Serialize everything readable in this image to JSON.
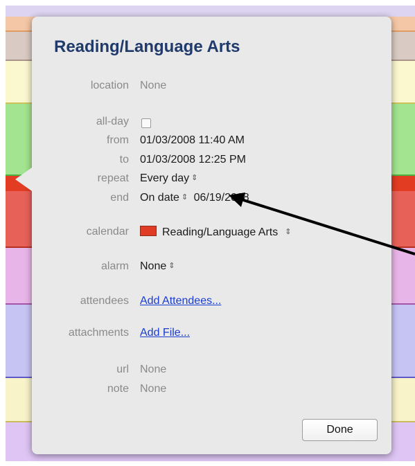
{
  "event": {
    "title": "Reading/Language Arts",
    "fields": {
      "location": {
        "label": "location",
        "value": "None"
      },
      "all_day": {
        "label": "all-day",
        "checked": false
      },
      "from": {
        "label": "from",
        "value": "01/03/2008 11:40 AM"
      },
      "to": {
        "label": "to",
        "value": "01/03/2008 12:25 PM"
      },
      "repeat": {
        "label": "repeat",
        "value": "Every day",
        "stepper": "⇕"
      },
      "end": {
        "label": "end",
        "value": "On date",
        "stepper": "⇕",
        "date": "06/19/2008"
      },
      "calendar": {
        "label": "calendar",
        "value": "Reading/Language Arts",
        "stepper": "⇕",
        "color": "#e03b25"
      },
      "alarm": {
        "label": "alarm",
        "value": "None",
        "stepper": "⇕"
      },
      "attendees": {
        "label": "attendees",
        "link": "Add Attendees..."
      },
      "attachments": {
        "label": "attachments",
        "link": "Add File..."
      },
      "url": {
        "label": "url",
        "value": "None"
      },
      "note": {
        "label": "note",
        "value": "None"
      }
    },
    "done_label": "Done"
  },
  "background_bands": [
    "#f4c7a6",
    "#d9cbc3",
    "#fbf7cf",
    "#a2e48f",
    "#e23c22",
    "#e86159",
    "#e8b5e8",
    "#c6c4f3",
    "#f8f3c9",
    "#dec5f4"
  ],
  "annotation_arrow_color": "#000000"
}
